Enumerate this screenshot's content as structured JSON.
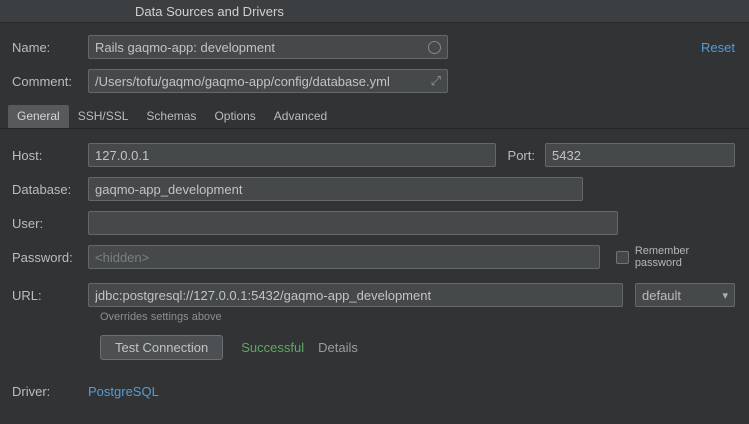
{
  "window": {
    "title": "Data Sources and Drivers"
  },
  "header": {
    "name_label": "Name:",
    "name_value": "Rails gaqmo-app: development",
    "reset_label": "Reset",
    "comment_label": "Comment:",
    "comment_value": "/Users/tofu/gaqmo/gaqmo-app/config/database.yml"
  },
  "tabs": [
    {
      "label": "General",
      "selected": true
    },
    {
      "label": "SSH/SSL",
      "selected": false
    },
    {
      "label": "Schemas",
      "selected": false
    },
    {
      "label": "Options",
      "selected": false
    },
    {
      "label": "Advanced",
      "selected": false
    }
  ],
  "form": {
    "host_label": "Host:",
    "host_value": "127.0.0.1",
    "port_label": "Port:",
    "port_value": "5432",
    "database_label": "Database:",
    "database_value": "gaqmo-app_development",
    "user_label": "User:",
    "user_value": "",
    "password_label": "Password:",
    "password_placeholder": "<hidden>",
    "remember_password_label": "Remember password",
    "url_label": "URL:",
    "url_value": "jdbc:postgresql://127.0.0.1:5432/gaqmo-app_development",
    "url_mode_selected": "default",
    "overrides_note": "Overrides settings above",
    "test_connection_label": "Test Connection",
    "test_result": "Successful",
    "details_label": "Details",
    "driver_label": "Driver:",
    "driver_value": "PostgreSQL"
  },
  "icons": {
    "expand": "⤢",
    "combo_arrow": "▾"
  },
  "colors": {
    "link_blue": "#569cd6",
    "success_green": "#5fa865",
    "panel_bg": "#313335",
    "field_bg": "#45494a"
  }
}
